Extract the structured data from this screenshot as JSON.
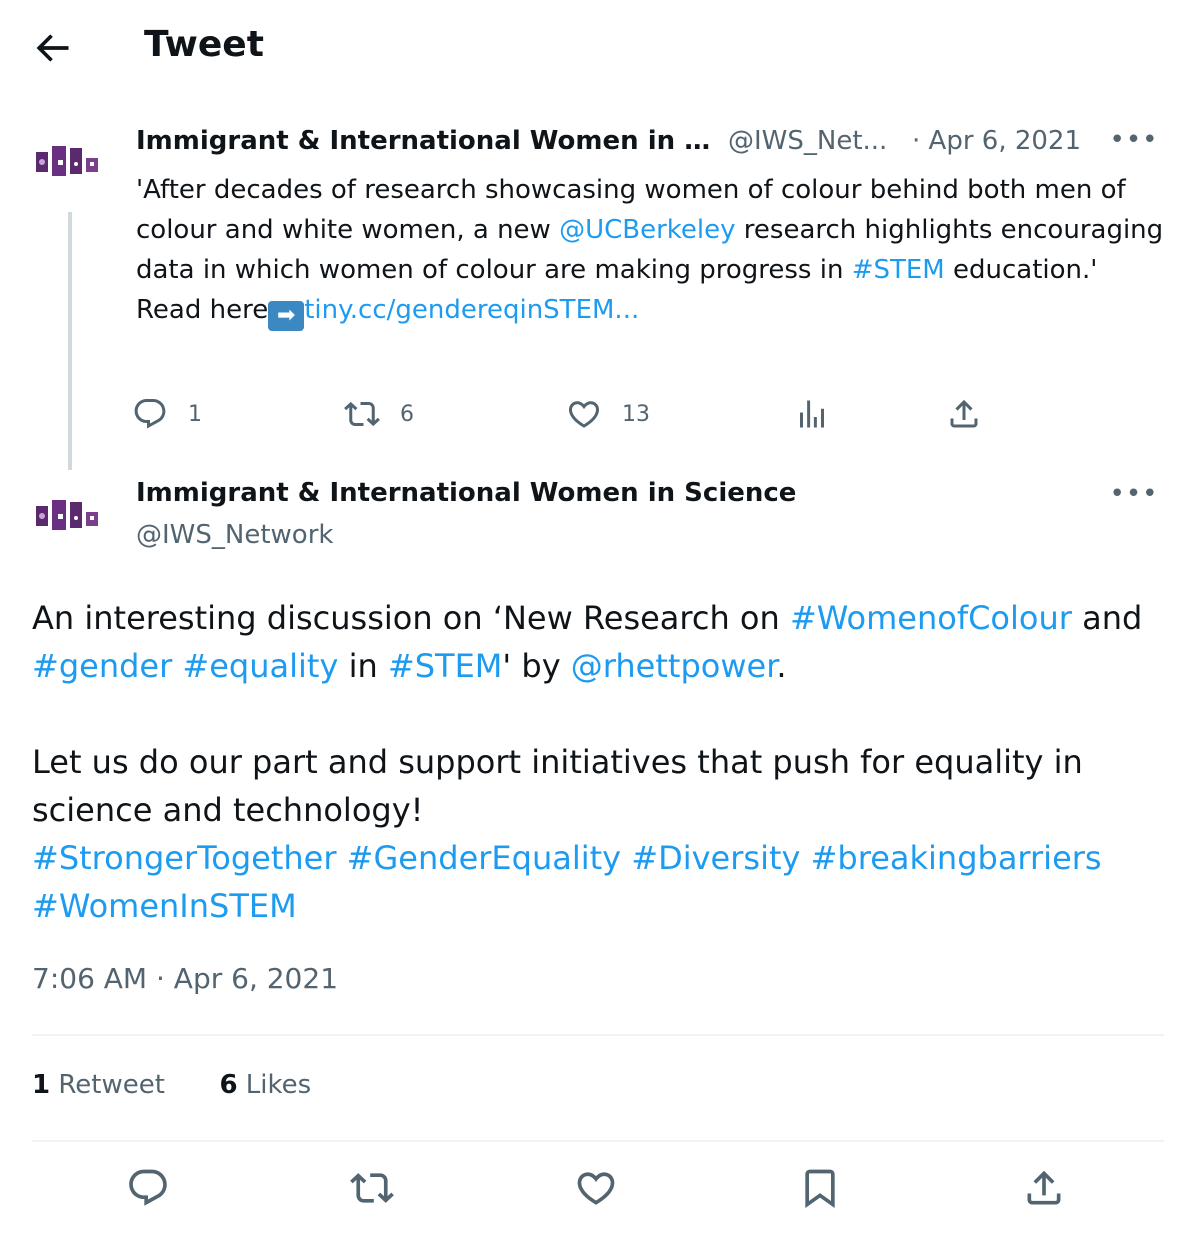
{
  "header": {
    "title": "Tweet"
  },
  "quoted": {
    "name": "Immigrant & International Women in S...",
    "handle": "@IWS_Net...",
    "date": "· Apr 6, 2021",
    "text_1": "'After decades of research showcasing women of colour behind both men of colour and white women, a new ",
    "mention": "@UCBerkeley",
    "text_2": " research highlights encouraging data in which women of colour are making progress in ",
    "hashtag": "#STEM",
    "text_3": " education.'",
    "read_here": "Read here",
    "arrow": "➡",
    "link": "tiny.cc/gendereqinSTEM...",
    "replies": "1",
    "retweets": "6",
    "likes": "13"
  },
  "main": {
    "name": "Immigrant & International Women in Science",
    "handle": "@IWS_Network",
    "t1": "An interesting discussion on ‘New Research on ",
    "h_women": "#WomenofColour",
    "t2": " and ",
    "h_gender": "#gender",
    "sp": " ",
    "h_equality": "#equality",
    "t3": " in ",
    "h_stem": "#STEM",
    "t4": "' by ",
    "m_rhett": "@rhettpower",
    "t5": ".",
    "p2": "Let us do our part and support initiatives that push for equality in science and technology!",
    "h_stronger": "#StrongerTogether",
    "h_genderequality": "#GenderEquality",
    "h_diversity": "#Diversity",
    "h_breaking": "#breakingbarriers",
    "h_womeninstem": "#WomenInSTEM",
    "timestamp": "7:06 AM · Apr 6, 2021"
  },
  "stats": {
    "retweet_count": "1",
    "retweet_label": " Retweet",
    "likes_count": "6",
    "likes_label": " Likes"
  },
  "icons": {
    "back": "arrow-left-icon",
    "more": "more-icon",
    "reply": "reply-icon",
    "retweet": "retweet-icon",
    "like": "heart-icon",
    "views": "analytics-icon",
    "share": "share-icon",
    "bookmark": "bookmark-icon"
  },
  "colors": {
    "link": "#1d9bf0",
    "secondary": "#536471",
    "avatar": "#5b2a6e"
  }
}
